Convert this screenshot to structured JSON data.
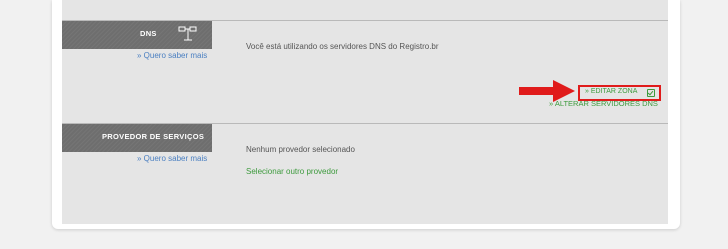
{
  "dns": {
    "title": "DNS",
    "icon": "network-icon",
    "more_link": "» Quero saber mais",
    "status_text": "Você está utilizando os servidores DNS do Registro.br",
    "edit_zone_label": "» EDITAR ZONA",
    "edit_icon": "edit-checkbox-icon",
    "change_servers_label": "» ALTERAR SERVIDORES DNS"
  },
  "provider": {
    "title": "PROVEDOR DE SERVIÇOS",
    "more_link": "» Quero saber mais",
    "status_text": "Nenhum provedor selecionado",
    "select_other_label": "Selecionar outro provedor"
  },
  "colors": {
    "header_bg": "#6e6e6e",
    "panel_bg": "#e5e5e5",
    "link_blue": "#4a7fc1",
    "action_green": "#3d9a3d",
    "highlight_red": "#e01b1b"
  }
}
